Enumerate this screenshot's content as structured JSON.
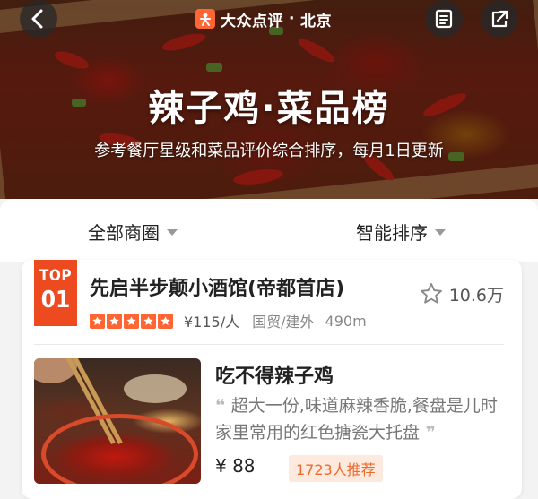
{
  "header": {
    "brand": "大众点评",
    "city_sep": "·",
    "city": "北京",
    "title": "辣子鸡·菜品榜",
    "subtitle": "参考餐厅星级和菜品评价综合排序，每月1日更新"
  },
  "filters": {
    "area": "全部商圈",
    "sort": "智能排序"
  },
  "listing": {
    "rank_top": "TOP",
    "rank_num": "01",
    "shop_name": "先启半步颠小酒馆(帝都首店)",
    "stars": 5,
    "price": "¥115/人",
    "area": "国贸/建外",
    "distance": "490m",
    "favorites": "10.6万",
    "dish_name": "吃不得辣子鸡",
    "dish_desc": "超大一份,味道麻辣香脆,餐盘是儿时家里常用的红色搪瓷大托盘",
    "dish_price": "¥ 88",
    "recommend": "1723人推荐"
  },
  "icons": [
    "back-icon",
    "share-list-icon",
    "share-icon",
    "star-outline-icon",
    "caret-down-icon"
  ],
  "colors": {
    "accent": "#ee4a1f",
    "star": "#ff6633",
    "recommend_bg": "#fde9dd"
  }
}
